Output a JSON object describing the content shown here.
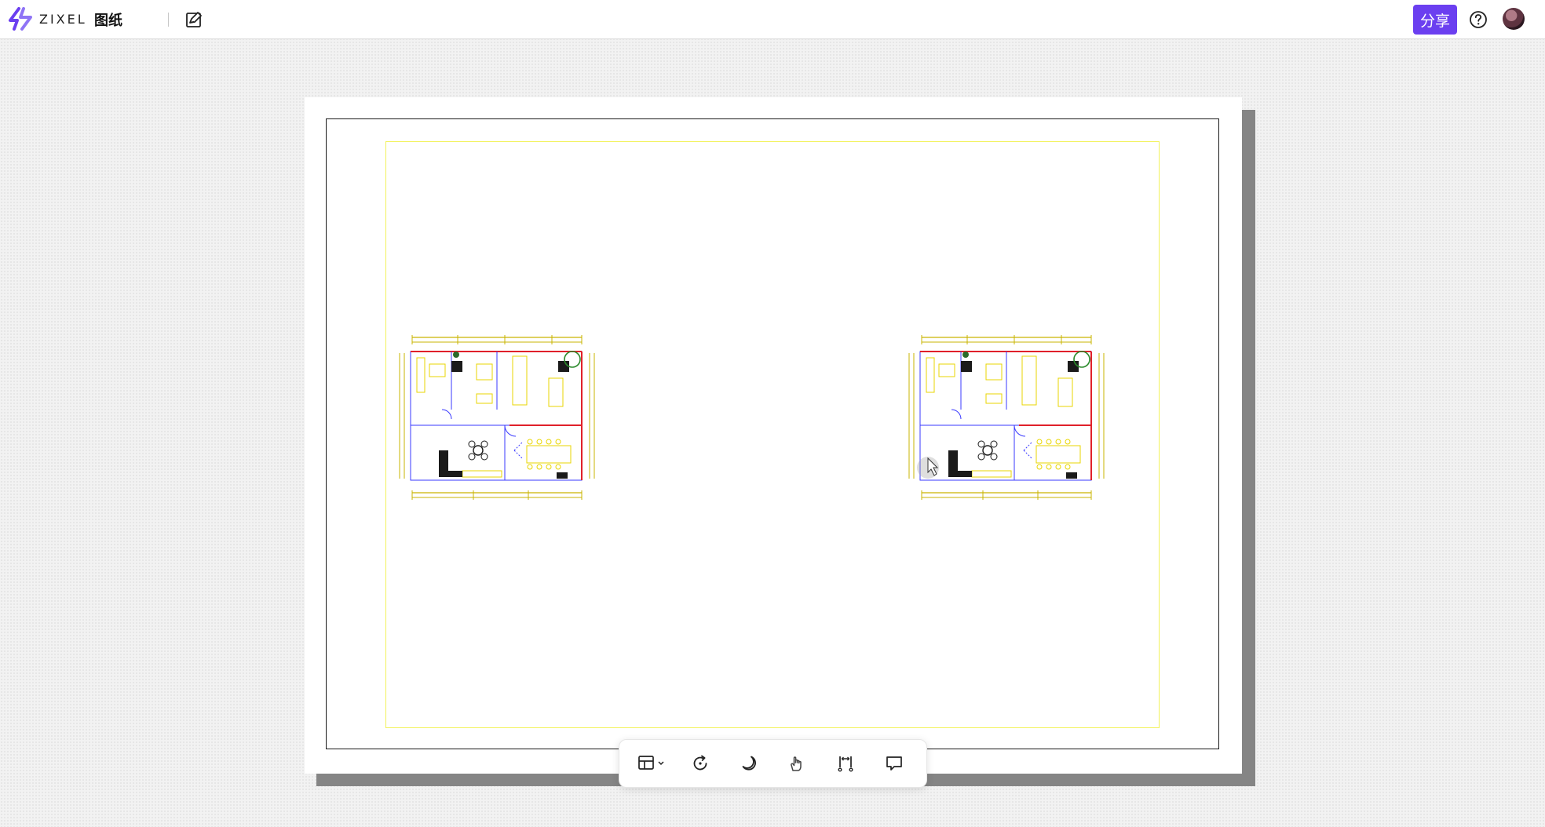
{
  "app": {
    "logo_text": "ZIXEL",
    "doc_title": "图纸",
    "brand_color": "#6b3ff0"
  },
  "header": {
    "edit_icon": "edit-drawing-icon",
    "share_label": "分享",
    "help_icon": "help-circle-icon",
    "avatar": "user-avatar"
  },
  "canvas": {
    "sheet_count": 1,
    "plan_views": [
      "floor-plan-left",
      "floor-plan-right"
    ]
  },
  "toolbar": {
    "tools": [
      {
        "name": "layout-view-dropdown",
        "icon": "layout-icon",
        "has_dropdown": true
      },
      {
        "name": "reset-view",
        "icon": "refresh-icon"
      },
      {
        "name": "dark-mode",
        "icon": "moon-icon"
      },
      {
        "name": "pan-hand",
        "icon": "hand-icon"
      },
      {
        "name": "measure",
        "icon": "measure-icon"
      },
      {
        "name": "comment",
        "icon": "comment-icon"
      }
    ]
  }
}
